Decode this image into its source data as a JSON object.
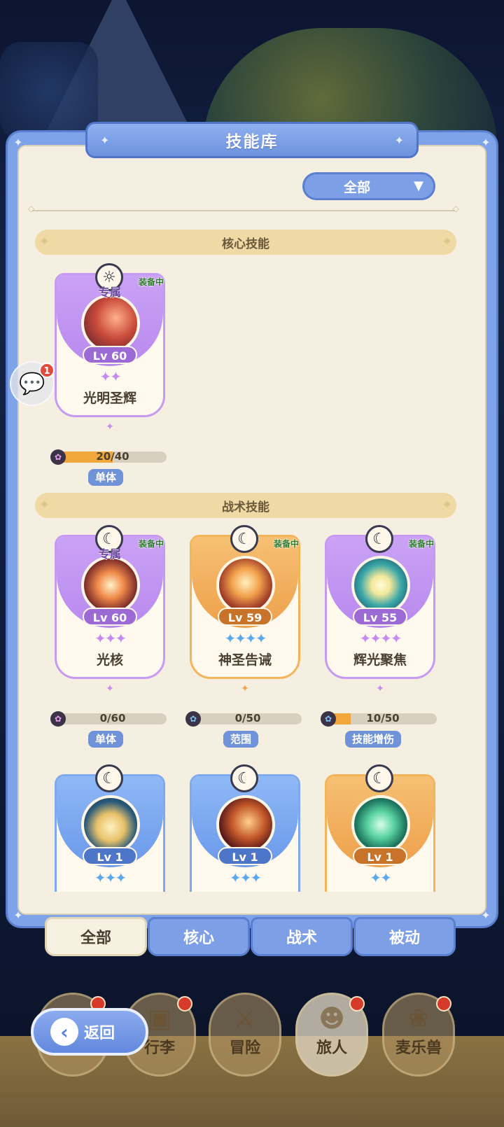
{
  "panel": {
    "title": "技能库"
  },
  "filter": {
    "selected": "全部",
    "arrow": "▼"
  },
  "sections": {
    "core": "核心技能",
    "tactical": "战术技能"
  },
  "core_skills": [
    {
      "name": "光明圣辉",
      "level": "Lv 60",
      "stars": "✦✦",
      "exclusive": "专属",
      "equipped": "装备中",
      "progress_text": "20/40",
      "progress": 0.5,
      "tag": "单体",
      "rarity": "purple",
      "badge_icon": "sun-icon"
    }
  ],
  "tactical_skills": [
    {
      "name": "光核",
      "level": "Lv 60",
      "stars": "✦✦✦",
      "exclusive": "专属",
      "equipped": "装备中",
      "progress_text": "0/60",
      "progress": 0,
      "tag": "单体",
      "rarity": "purple",
      "badge_icon": "moon-icon"
    },
    {
      "name": "神圣告诫",
      "level": "Lv 59",
      "stars": "✦✦✦✦",
      "equipped": "装备中",
      "progress_text": "0/50",
      "progress": 0,
      "tag": "范围",
      "rarity": "orange",
      "badge_icon": "moon-icon"
    },
    {
      "name": "辉光聚焦",
      "level": "Lv 55",
      "stars": "✦✦✦✦",
      "equipped": "装备中",
      "progress_text": "10/50",
      "progress": 0.2,
      "tag": "技能增伤",
      "rarity": "purple",
      "badge_icon": "moon-icon"
    },
    {
      "level": "Lv 1",
      "stars": "✦✦✦",
      "rarity": "blue",
      "badge_icon": "moon-icon"
    },
    {
      "level": "Lv 1",
      "stars": "✦✦✦",
      "rarity": "blue",
      "badge_icon": "moon-icon"
    },
    {
      "level": "Lv 1",
      "stars": "✦✦",
      "rarity": "orange",
      "badge_icon": "moon-icon"
    }
  ],
  "tabs": [
    {
      "label": "全部",
      "active": true
    },
    {
      "label": "核心"
    },
    {
      "label": "战术"
    },
    {
      "label": "被动"
    }
  ],
  "nav": [
    {
      "label": "",
      "icon": "bag-icon"
    },
    {
      "label": "行李",
      "icon": "backpack-icon"
    },
    {
      "label": "冒险",
      "icon": "swords-icon"
    },
    {
      "label": "旅人",
      "icon": "traveler-icon"
    },
    {
      "label": "麦乐兽",
      "icon": "pet-icon"
    }
  ],
  "back": {
    "label": "返回"
  },
  "chat": {
    "badge": "1"
  },
  "colors": {
    "panel_blue": "#7fa3e8",
    "parchment": "#f4efe1",
    "purple_card": "#b889ee",
    "orange_card": "#eea04b",
    "blue_card": "#6a99ea",
    "progress_fill": "#f0a73c"
  }
}
